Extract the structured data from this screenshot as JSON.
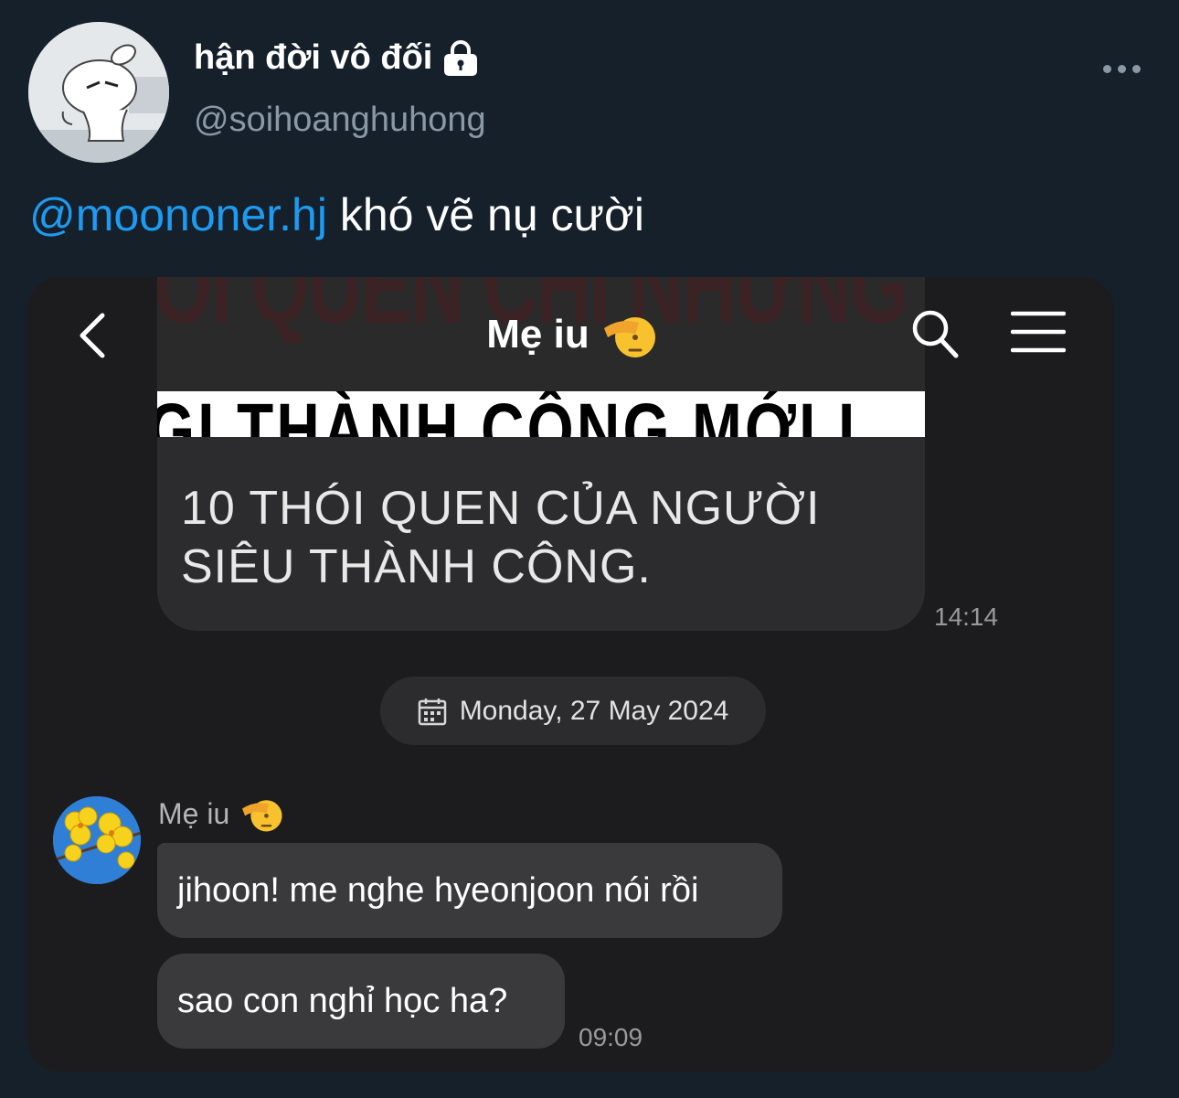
{
  "tweet": {
    "display_name": "hận đời vô đối",
    "handle": "@soihoanghuhong",
    "mention": "@moononer.hj",
    "text": " khó vẽ nụ cười",
    "icons": {
      "protected": "lock-icon",
      "more": "more-options-icon"
    }
  },
  "chat": {
    "title": "Mẹ iu",
    "title_emoji": "saluting-face-emoji",
    "banner": {
      "ghost_text": "ÓI QUEN CHI NHỮNG T",
      "strip_text": "GI THÀNH CÔNG MỚI L",
      "caption_line1": "10 THÓI QUEN CỦA NGƯỜI",
      "caption_line2": "SIÊU THÀNH CÔNG.",
      "time": "14:14"
    },
    "date_separator": "Monday, 27 May 2024",
    "sender_name": "Mẹ iu",
    "messages": [
      {
        "text": "jihoon! me nghe hyeonjoon nói rồi"
      },
      {
        "text": "sao con nghỉ học ha?"
      }
    ],
    "last_time": "09:09",
    "colors": {
      "background": "#15202b",
      "mention": "#1d9bf0",
      "chat_bg": "#1c1c1e",
      "bubble": "#3a3a3c"
    }
  }
}
